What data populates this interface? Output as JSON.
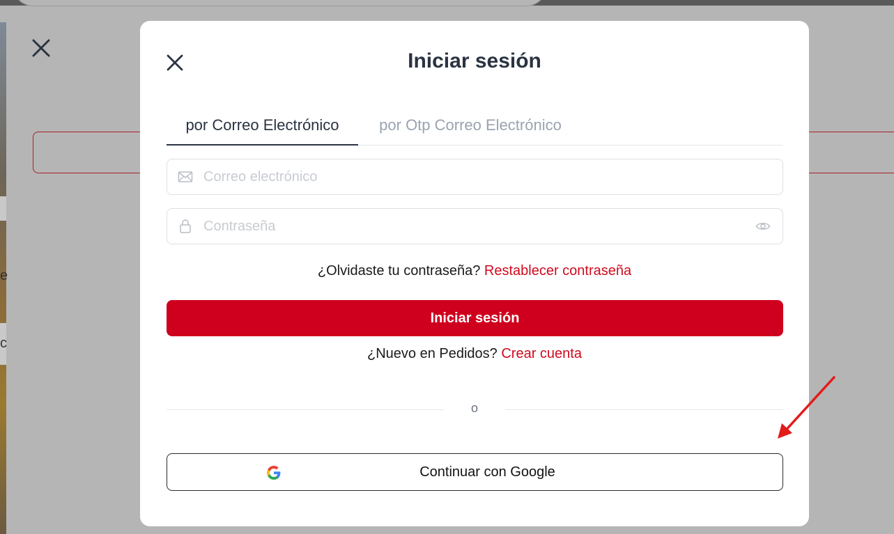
{
  "background": {
    "close_icon": "close-icon",
    "edge_letters": [
      "e",
      "c"
    ]
  },
  "modal": {
    "title": "Iniciar sesión",
    "close_icon": "close-icon",
    "tabs": [
      {
        "label": "por Correo Electrónico",
        "active": true
      },
      {
        "label": "por Otp Correo Electrónico",
        "active": false
      }
    ],
    "email_field": {
      "placeholder": "Correo electrónico",
      "value": "",
      "icon": "envelope-icon"
    },
    "password_field": {
      "placeholder": "Contraseña",
      "value": "",
      "icon": "lock-icon",
      "toggle_icon": "eye-icon"
    },
    "forgot": {
      "text": "¿Olvidaste tu contraseña?",
      "link": "Restablecer contraseña"
    },
    "login_button": "Iniciar sesión",
    "signup": {
      "text": "¿Nuevo en Pedidos?",
      "link": "Crear cuenta"
    },
    "divider_text": "o",
    "google_button": {
      "label": "Continuar con Google",
      "icon": "google-icon"
    }
  },
  "colors": {
    "brand_red": "#cf001d",
    "title": "#2a3342",
    "overlay": "#b5b5b5",
    "annotation_arrow": "#e31b1b"
  }
}
